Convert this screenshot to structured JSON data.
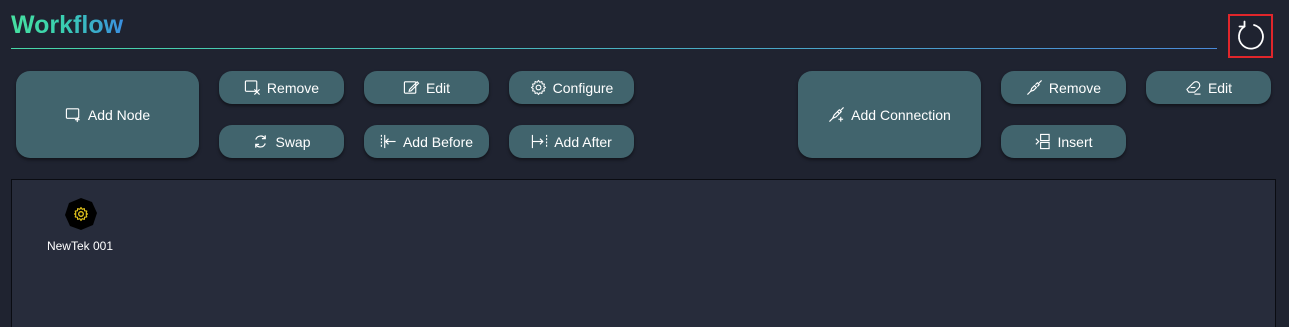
{
  "header": {
    "title": "Workflow",
    "refresh_icon": "refresh-icon"
  },
  "node_toolbar": {
    "add_node": {
      "label": "Add Node",
      "icon": "add-node-icon"
    },
    "remove": {
      "label": "Remove",
      "icon": "remove-node-icon"
    },
    "edit": {
      "label": "Edit",
      "icon": "edit-icon"
    },
    "configure": {
      "label": "Configure",
      "icon": "gear-icon"
    },
    "swap": {
      "label": "Swap",
      "icon": "swap-icon"
    },
    "add_before": {
      "label": "Add Before",
      "icon": "add-before-icon"
    },
    "add_after": {
      "label": "Add After",
      "icon": "add-after-icon"
    }
  },
  "connection_toolbar": {
    "add_connection": {
      "label": "Add Connection",
      "icon": "add-connection-icon"
    },
    "remove": {
      "label": "Remove",
      "icon": "remove-connection-icon"
    },
    "edit": {
      "label": "Edit",
      "icon": "edit-connection-icon"
    },
    "insert": {
      "label": "Insert",
      "icon": "insert-icon"
    }
  },
  "canvas": {
    "nodes": [
      {
        "label": "NewTek 001",
        "icon": "gear-node-icon",
        "icon_color": "#e8c81c"
      }
    ]
  },
  "colors": {
    "background": "#1f2330",
    "canvas": "#272c3b",
    "button": "#41646d",
    "highlight": "#e0262b",
    "title_gradient_start": "#46e0a0",
    "title_gradient_end": "#3a8fe0"
  }
}
